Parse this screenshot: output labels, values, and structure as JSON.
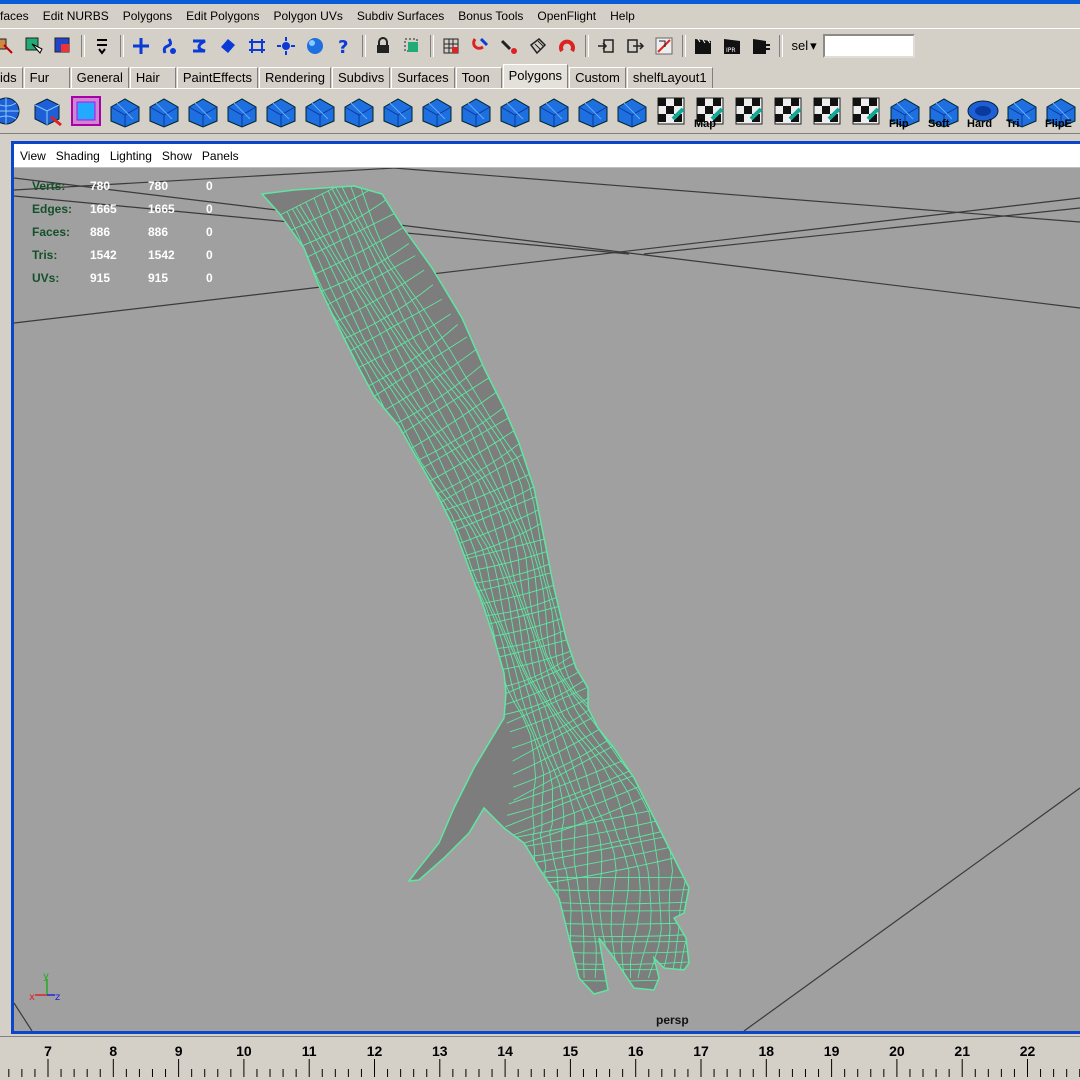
{
  "menubar": {
    "items": [
      "rfaces",
      "Edit NURBS",
      "Polygons",
      "Edit Polygons",
      "Polygon UVs",
      "Subdiv Surfaces",
      "Bonus Tools",
      "OpenFlight",
      "Help"
    ]
  },
  "statusline": {
    "icons": [
      "select-hierarchy-icon",
      "select-object-icon",
      "select-component-icon",
      "snap-menu-icon",
      "snap-grid-icon",
      "snap-curve-icon",
      "snap-point-icon",
      "snap-view-plane-icon",
      "snap-live-surface-icon",
      "history-icon",
      "sphere-icon",
      "help-icon",
      "lock-icon",
      "select-highlight-icon",
      "construction-history-icon",
      "magnet-icon",
      "input-ops-icon",
      "output-ops-icon",
      "render-icon",
      "ipr-icon",
      "render-globals-icon"
    ],
    "selection_mode": "sel",
    "input_value": ""
  },
  "shelf_tabs": {
    "tabs": [
      "ids",
      "Fur",
      "General",
      "Hair",
      "PaintEffects",
      "Rendering",
      "Subdivs",
      "Surfaces",
      "Toon",
      "Polygons",
      "Custom",
      "shelfLayout1"
    ],
    "active": "Polygons"
  },
  "shelf": {
    "icons": [
      {
        "name": "poly-sphere-icon",
        "label": ""
      },
      {
        "name": "poly-cube-icon",
        "label": ""
      },
      {
        "name": "poly-cube-selected-icon",
        "label": ""
      },
      {
        "name": "split-polygon-icon",
        "label": ""
      },
      {
        "name": "poly-select-icon",
        "label": ""
      },
      {
        "name": "extrude-face-icon",
        "label": ""
      },
      {
        "name": "extrude-edge-icon",
        "label": ""
      },
      {
        "name": "bevel-icon",
        "label": ""
      },
      {
        "name": "chamfer-icon",
        "label": ""
      },
      {
        "name": "append-polygon-icon",
        "label": ""
      },
      {
        "name": "split-edge-icon",
        "label": ""
      },
      {
        "name": "cut-faces-icon",
        "label": ""
      },
      {
        "name": "merge-vertices-icon",
        "label": ""
      },
      {
        "name": "bridge-icon",
        "label": ""
      },
      {
        "name": "combine-icon",
        "label": ""
      },
      {
        "name": "separate-icon",
        "label": ""
      },
      {
        "name": "extract-icon",
        "label": ""
      },
      {
        "name": "uv-checker-icon",
        "label": ""
      },
      {
        "name": "uv-map-icon",
        "label": "Map"
      },
      {
        "name": "planar-map-icon",
        "label": ""
      },
      {
        "name": "spherical-map-icon",
        "label": ""
      },
      {
        "name": "cylindrical-map-icon",
        "label": ""
      },
      {
        "name": "auto-map-icon",
        "label": ""
      },
      {
        "name": "flip-normals-icon",
        "label": "Flip"
      },
      {
        "name": "soften-edge-icon",
        "label": "Soft"
      },
      {
        "name": "harden-edge-icon",
        "label": "Hard"
      },
      {
        "name": "triangulate-icon",
        "label": "Tri"
      },
      {
        "name": "flip-triangle-icon",
        "label": "FlipE"
      }
    ]
  },
  "panel": {
    "menus": [
      "View",
      "Shading",
      "Lighting",
      "Show",
      "Panels"
    ],
    "camera": "persp"
  },
  "hud": {
    "rows": [
      {
        "label": "Verts:",
        "v1": "780",
        "v2": "780",
        "v3": "0"
      },
      {
        "label": "Edges:",
        "v1": "1665",
        "v2": "1665",
        "v3": "0"
      },
      {
        "label": "Faces:",
        "v1": "886",
        "v2": "886",
        "v3": "0"
      },
      {
        "label": "Tris:",
        "v1": "1542",
        "v2": "1542",
        "v3": "0"
      },
      {
        "label": "UVs:",
        "v1": "915",
        "v2": "915",
        "v3": "0"
      }
    ]
  },
  "axis": {
    "x": "x",
    "y": "y",
    "z": "z"
  },
  "timeslider": {
    "frames": [
      "7",
      "8",
      "9",
      "10",
      "11",
      "12",
      "13",
      "14",
      "15",
      "16",
      "17",
      "18",
      "19",
      "20",
      "21",
      "22"
    ]
  },
  "colors": {
    "viewport_bg": "#a0a0a0",
    "wireframe": "#5fe6a2",
    "mesh_fill": "#7d7d7d",
    "panel_border": "#0b46c8",
    "hud_label": "#14502a"
  }
}
